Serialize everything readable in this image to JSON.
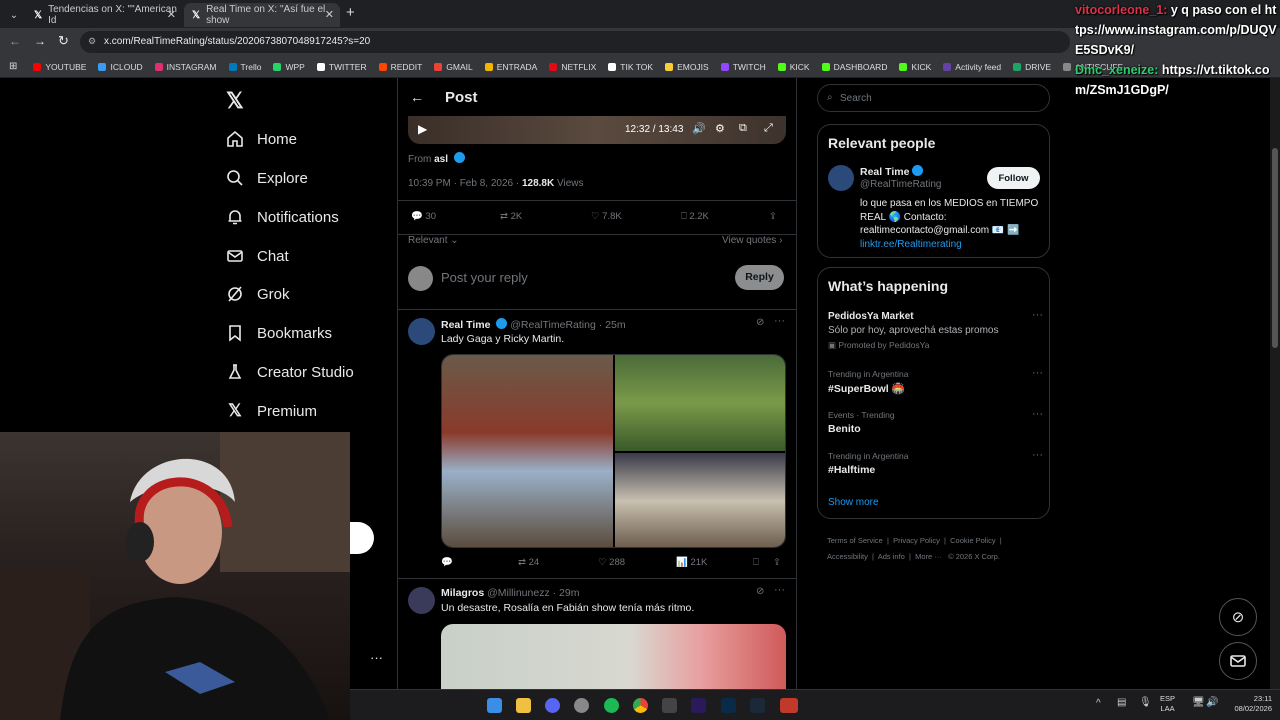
{
  "browser": {
    "tabs": [
      {
        "title": "Tendencias on X: \"\"American Id",
        "close": "✕"
      },
      {
        "title": "Real Time on X: \"Así fue el show",
        "close": "✕"
      }
    ],
    "new_tab": "+",
    "url": "x.com/RealTimeRating/status/2020673807048917245?s=20",
    "bookmarks": [
      "YOUTUBE",
      "ICLOUD",
      "INSTAGRAM",
      "Trello",
      "WPP",
      "TWITTER",
      "REDDIT",
      "GMAIL",
      "ENTRADA",
      "NETFLIX",
      "TIK TOK",
      "EMOJIS",
      "TWITCH",
      "KICK",
      "DASHBOARD",
      "KICK",
      "Activity feed",
      "DRIVE",
      "ANTISCUFF"
    ],
    "bookmark_colors": [
      "#ff0000",
      "#3a9cf0",
      "#e1306c",
      "#0079bf",
      "#25d366",
      "#ffffff",
      "#ff4500",
      "#ea4335",
      "#f4b400",
      "#e50914",
      "#ffffff",
      "#f9ce34",
      "#9146ff",
      "#53fc18",
      "#53fc18",
      "#53fc18",
      "#6441a5",
      "#1fa463",
      "#888888"
    ]
  },
  "nav": {
    "items": [
      "Home",
      "Explore",
      "Notifications",
      "Chat",
      "Grok",
      "Bookmarks",
      "Creator Studio",
      "Premium"
    ],
    "more": "···"
  },
  "post": {
    "header": "Post",
    "video_time": "12:32 / 13:43",
    "from_label": "From",
    "from_user": "asl",
    "time": "10:39 PM · Feb 8, 2026 ·",
    "views_count": "128.8K",
    "views_label": "Views",
    "stats": {
      "replies": "30",
      "reposts": "2K",
      "likes": "7.8K",
      "bookmarks": "2.2K"
    },
    "relevant": "Relevant",
    "view_quotes": "View quotes",
    "reply_placeholder": "Post your reply",
    "reply_button": "Reply"
  },
  "replies": [
    {
      "name": "Real Time",
      "handle": "@RealTimeRating · 25m",
      "text": "Lady Gaga y Ricky Martin.",
      "stats": {
        "reposts": "24",
        "likes": "288",
        "views": "21K"
      }
    },
    {
      "name": "Milagros",
      "handle": "@Millinunezz · 29m",
      "text": "Un desastre, Rosalía en Fabián show tenía más ritmo."
    }
  ],
  "right": {
    "search_placeholder": "Search",
    "relevant_title": "Relevant people",
    "person": {
      "name": "Real Time",
      "handle": "@RealTimeRating",
      "follow": "Follow",
      "bio1": "lo que pasa en los MEDIOS en TIEMPO",
      "bio2": "REAL 🌎 Contacto:",
      "bio3": "realtimecontacto@gmail.com 📧 ➡️",
      "link": "linktr.ee/Realtimerating"
    },
    "happening_title": "What’s happening",
    "trends": [
      {
        "context": "PedidosYa Market",
        "title": "Sólo por hoy, aprovechá estas promos",
        "promo": "Promoted by PedidosYa"
      },
      {
        "context": "Trending in Argentina",
        "title": "#SuperBowl 🏟️"
      },
      {
        "context": "Events · Trending",
        "title": "Benito"
      },
      {
        "context": "Trending in Argentina",
        "title": "#Halftime"
      }
    ],
    "show_more": "Show more",
    "footer": [
      "Terms of Service",
      "|",
      "Privacy Policy",
      "|",
      "Cookie Policy",
      "|",
      "Accessibility",
      "|",
      "Ads info",
      "|",
      "More ···",
      "© 2026 X Corp."
    ]
  },
  "chat_overlay": {
    "user1": "vitocorleone_1:",
    "msg1": "y q paso con el https://www.instagram.com/p/DUQVE5SDvK9/",
    "user2": "Dmc_xeneize:",
    "msg2": "https://vt.tiktok.com/ZSmJ1GDgP/"
  },
  "system": {
    "lang1": "ESP",
    "lang2": "LAA",
    "time": "23:11",
    "date": "08/02/2026"
  }
}
